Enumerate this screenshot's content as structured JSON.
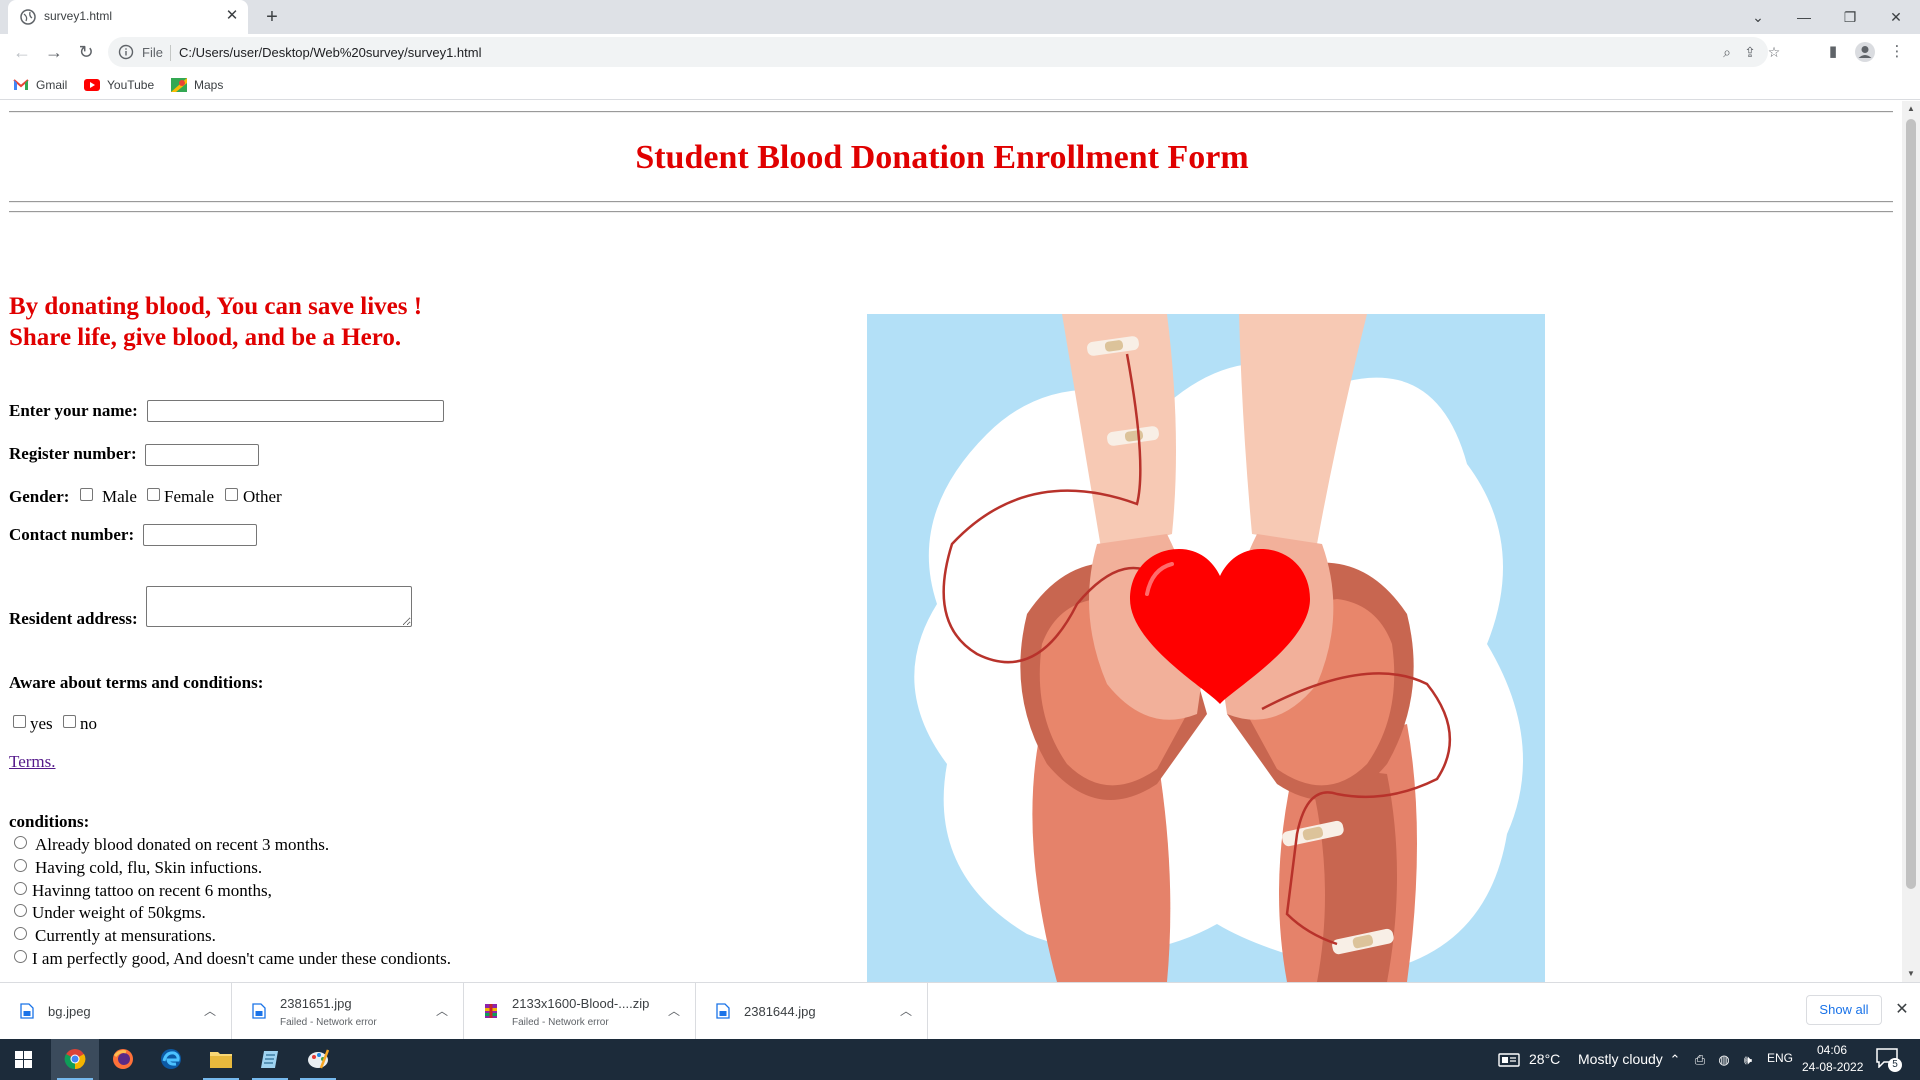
{
  "browser": {
    "tab_title": "survey1.html",
    "tab_close": "✕",
    "new_tab": "+",
    "omnibox_file_label": "File",
    "url": "C:/Users/user/Desktop/Web%20survey/survey1.html",
    "bookmarks": [
      "Gmail",
      "YouTube",
      "Maps"
    ]
  },
  "page": {
    "title": "Student Blood Donation Enrollment Form",
    "tagline_1": "By donating blood, You can save lives !",
    "tagline_2": "Share life, give blood, and be a Hero.",
    "name_label": "Enter your name:",
    "name_value": "",
    "register_label": "Register number:",
    "register_value": "",
    "gender_label": "Gender:",
    "gender_options": [
      "Male",
      "Female",
      "Other"
    ],
    "contact_label": "Contact number:",
    "contact_value": "",
    "address_label": "Resident address:",
    "terms_heading": "Aware about terms and conditions:",
    "terms_options": [
      "yes",
      "no"
    ],
    "terms_link": "Terms.",
    "conditions_heading": "conditions:",
    "conditions": [
      "Already blood donated on recent 3 months.",
      "Having cold, flu, Skin infuctions.",
      "Havinng tattoo on recent 6 months,",
      "Under weight of 50kgms.",
      "Currently at mensurations.",
      "I am perfectly good, And doesn't came under these condionts."
    ]
  },
  "downloads": [
    {
      "name": "bg.jpeg",
      "status": ""
    },
    {
      "name": "2381651.jpg",
      "status": "Failed - Network error"
    },
    {
      "name": "2133x1600-Blood-....zip",
      "status": "Failed - Network error"
    },
    {
      "name": "2381644.jpg",
      "status": ""
    }
  ],
  "downloads_show_all": "Show all",
  "taskbar": {
    "temperature": "28°C",
    "weather": "Mostly cloudy",
    "language": "ENG",
    "time": "04:06",
    "date": "24-08-2022",
    "notification_count": "5"
  },
  "colors": {
    "title_red": "#e00000",
    "link_purple": "#551a8b",
    "illustration_bg": "#b3e0f7",
    "heart_red": "#ff0000",
    "taskbar_bg": "#1c2b3a"
  }
}
